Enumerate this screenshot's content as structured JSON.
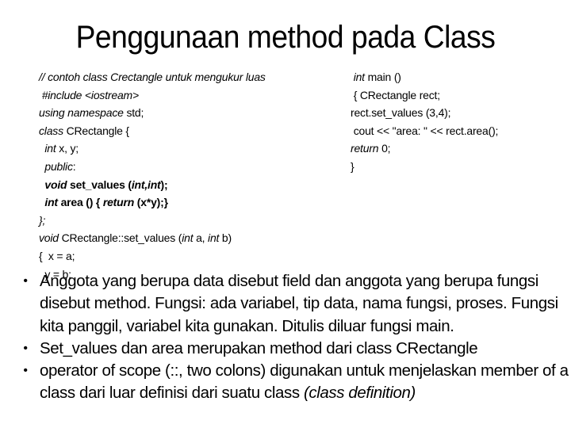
{
  "slide": {
    "title": "Penggunaan method pada Class"
  },
  "code_left": {
    "lines": [
      [
        {
          "t": "// contoh class Crectangle untuk mengukur luas",
          "s": "i"
        }
      ],
      [
        {
          "t": " #include <iostream>",
          "s": "i"
        }
      ],
      [
        {
          "t": "using namespace",
          "s": "i"
        },
        {
          "t": " std;",
          "s": ""
        }
      ],
      [
        {
          "t": "class",
          "s": "i"
        },
        {
          "t": " CRectangle {",
          "s": ""
        }
      ],
      [
        {
          "t": "  int",
          "s": "i"
        },
        {
          "t": " x, y;",
          "s": ""
        }
      ],
      [
        {
          "t": "  public",
          "s": "i"
        },
        {
          "t": ":",
          "s": ""
        }
      ],
      [
        {
          "t": "  void",
          "s": "bi"
        },
        {
          "t": " set_values (",
          "s": "b"
        },
        {
          "t": "int,int",
          "s": "bi"
        },
        {
          "t": ");",
          "s": "b"
        }
      ],
      [
        {
          "t": "  int",
          "s": "bi"
        },
        {
          "t": " area () { ",
          "s": "b"
        },
        {
          "t": "return",
          "s": "bi"
        },
        {
          "t": " (x*y);}",
          "s": "b"
        }
      ],
      [
        {
          "t": "};",
          "s": "i"
        }
      ],
      [
        {
          "t": "void",
          "s": "i"
        },
        {
          "t": " CRectangle::set_values (",
          "s": ""
        },
        {
          "t": "int",
          "s": "i"
        },
        {
          "t": " a, ",
          "s": ""
        },
        {
          "t": "int",
          "s": "i"
        },
        {
          "t": " b)",
          "s": ""
        }
      ],
      [
        {
          "t": "{  x = a;",
          "s": ""
        }
      ],
      [
        {
          "t": "  y = b;",
          "s": ""
        }
      ]
    ]
  },
  "code_right": {
    "lines": [
      [
        {
          "t": " int",
          "s": "i"
        },
        {
          "t": " main ()",
          "s": ""
        }
      ],
      [
        {
          "t": " { CRectangle rect;",
          "s": ""
        }
      ],
      [
        {
          "t": "rect.set_values (3,4);",
          "s": ""
        }
      ],
      [
        {
          "t": " cout << \"area: \" << rect.area();",
          "s": ""
        }
      ],
      [
        {
          "t": "return",
          "s": "i"
        },
        {
          "t": " 0;",
          "s": ""
        }
      ],
      [
        {
          "t": "}",
          "s": ""
        }
      ]
    ]
  },
  "bullets": [
    {
      "marker": "•",
      "segments": [
        {
          "t": "Anggota yang berupa data disebut field dan anggota yang berupa fungsi  disebut  method.  Fungsi: ada variabel, tip data, nama fungsi, proses. Fungsi kita panggil, variabel kita gunakan. Ditulis diluar fungsi main.",
          "s": ""
        }
      ]
    },
    {
      "marker": "•",
      "segments": [
        {
          "t": "Set_values dan area merupakan method dari class CRectangle",
          "s": ""
        }
      ]
    },
    {
      "marker": "•",
      "segments": [
        {
          "t": "operator of scope (::, two colons) digunakan untuk menjelaskan member of a class dari luar definisi dari suatu class ",
          "s": ""
        },
        {
          "t": "(class definition)",
          "s": "i"
        }
      ]
    }
  ]
}
